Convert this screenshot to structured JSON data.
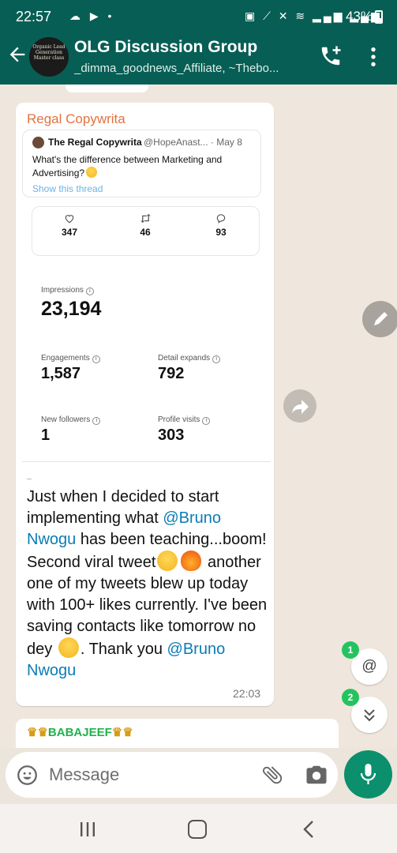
{
  "status_bar": {
    "time": "22:57",
    "battery": "43%"
  },
  "header": {
    "group_avatar_text": "Organic Lead Generation Master class",
    "title": "OLG Discussion Group",
    "subtitle": "_dimma_goodnews_Affiliate, ~Thebo..."
  },
  "message": {
    "sender": "Regal Copywrita",
    "sender_color": "#e2733f",
    "embedded_tweet": {
      "author_name": "The Regal Copywrita",
      "handle_date": "@HopeAnast... · May 8",
      "text": "What's the difference between Marketing and Advertising?",
      "show_thread_label": "Show this thread",
      "likes": "347",
      "retweets": "46",
      "replies": "93"
    },
    "analytics": {
      "impressions_label": "Impressions",
      "impressions_value": "23,194",
      "engagements_label": "Engagements",
      "engagements_value": "1,587",
      "detail_expands_label": "Detail expands",
      "detail_expands_value": "792",
      "new_followers_label": "New followers",
      "new_followers_value": "1",
      "profile_visits_label": "Profile visits",
      "profile_visits_value": "303"
    },
    "body": {
      "part1": "Just when I decided to start implementing what ",
      "mention1": "@Bruno Nwogu",
      "part2": " has been teaching...boom! Second viral tweet",
      "part3": " another one of my tweets blew up today with 100+ likes currently. I've been saving contacts like tomorrow no dey ",
      "part4": ". Thank you ",
      "mention2": "@Bruno Nwogu"
    },
    "time": "22:03"
  },
  "next_message": {
    "sender": "BABAJEEF",
    "sender_color": "#21b14d"
  },
  "floating": {
    "mention_badge": "1",
    "mention_symbol": "@",
    "unread_badge": "2"
  },
  "input": {
    "placeholder": "Message"
  },
  "colors": {
    "header_bg": "#075e54",
    "mention": "#0a7cb6",
    "mic_bg": "#0b8f6d",
    "badge": "#25c35f"
  },
  "icons": [
    "back-arrow-icon",
    "add-call-icon",
    "more-vertical-icon",
    "heart-icon",
    "retweet-icon",
    "reply-icon",
    "info-icon",
    "edit-pencil-icon",
    "forward-icon",
    "at-icon",
    "double-chevron-down-icon",
    "smiley-icon",
    "attach-icon",
    "camera-icon",
    "mic-icon",
    "nav-recents-icon",
    "nav-home-icon",
    "nav-back-icon"
  ]
}
